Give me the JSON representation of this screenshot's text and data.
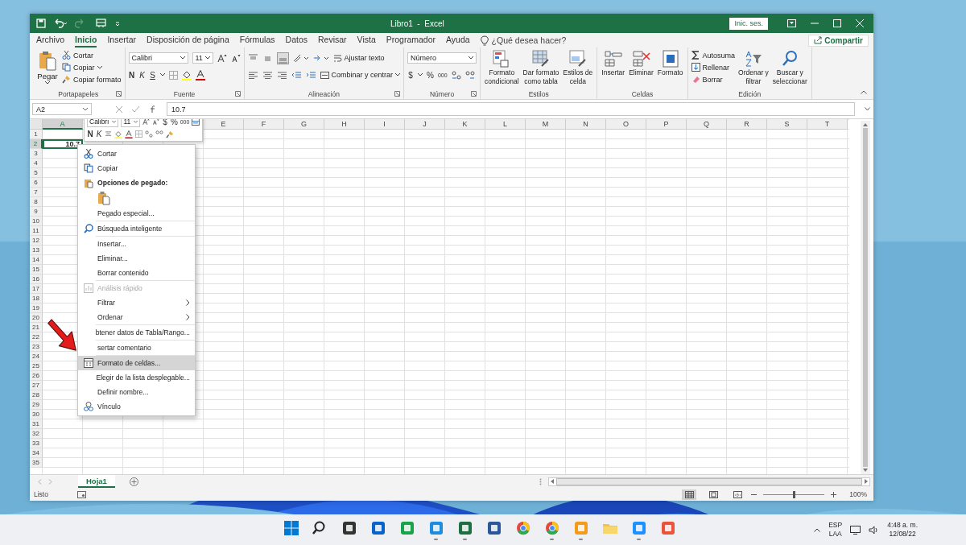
{
  "window": {
    "title": "Libro1  -  Excel",
    "signin": "Inic. ses."
  },
  "menu_tabs": [
    {
      "label": "Archivo",
      "selected": false
    },
    {
      "label": "Inicio",
      "selected": true
    },
    {
      "label": "Insertar",
      "selected": false
    },
    {
      "label": "Disposición de página",
      "selected": false
    },
    {
      "label": "Fórmulas",
      "selected": false
    },
    {
      "label": "Datos",
      "selected": false
    },
    {
      "label": "Revisar",
      "selected": false
    },
    {
      "label": "Vista",
      "selected": false
    },
    {
      "label": "Programador",
      "selected": false
    },
    {
      "label": "Ayuda",
      "selected": false
    }
  ],
  "tell_me": {
    "placeholder": "¿Qué desea hacer?"
  },
  "share": "Compartir",
  "ribbon": {
    "clipboard": {
      "label": "Portapapeles",
      "paste": "Pegar",
      "cut": "Cortar",
      "copy": "Copiar",
      "format_painter": "Copiar formato"
    },
    "font": {
      "label": "Fuente",
      "family": "Calibri",
      "size": "11",
      "bold": "N",
      "italic": "K",
      "underline": "S"
    },
    "alignment": {
      "label": "Alineación",
      "wrap": "Ajustar texto",
      "merge": "Combinar y centrar"
    },
    "number": {
      "label": "Número",
      "format": "Número",
      "currency": "$",
      "percent": "%",
      "thousands": "000"
    },
    "styles": {
      "label": "Estilos",
      "items": [
        {
          "lines": [
            "Formato",
            "condicional"
          ]
        },
        {
          "lines": [
            "Dar formato",
            "como tabla"
          ]
        },
        {
          "lines": [
            "Estilos de",
            "celda"
          ]
        }
      ]
    },
    "cells": {
      "label": "Celdas",
      "items": [
        {
          "lines": [
            "Insertar"
          ]
        },
        {
          "lines": [
            "Eliminar"
          ]
        },
        {
          "lines": [
            "Formato"
          ]
        }
      ]
    },
    "editing": {
      "label": "Edición",
      "autosum": "Autosuma",
      "fill": "Rellenar",
      "clear": "Borrar",
      "sort": {
        "lines": [
          "Ordenar y",
          "filtrar"
        ]
      },
      "find": {
        "lines": [
          "Buscar y",
          "seleccionar"
        ]
      }
    }
  },
  "formula_bar": {
    "name_box": "A2",
    "value": "10.7"
  },
  "mini_toolbar": {
    "font": "Calibri",
    "size": "11",
    "currency": "$",
    "percent": "%",
    "thousands": "000",
    "bold": "N",
    "italic": "K"
  },
  "columns": [
    {
      "label": "A",
      "selected": true
    },
    {
      "label": "E",
      "selected": false
    },
    {
      "label": "F",
      "selected": false
    },
    {
      "label": "G",
      "selected": false
    },
    {
      "label": "H",
      "selected": false
    },
    {
      "label": "I",
      "selected": false
    },
    {
      "label": "J",
      "selected": false
    },
    {
      "label": "K",
      "selected": false
    },
    {
      "label": "L",
      "selected": false
    },
    {
      "label": "M",
      "selected": false
    },
    {
      "label": "N",
      "selected": false
    },
    {
      "label": "O",
      "selected": false
    },
    {
      "label": "P",
      "selected": false
    },
    {
      "label": "Q",
      "selected": false
    },
    {
      "label": "R",
      "selected": false
    },
    {
      "label": "S",
      "selected": false
    },
    {
      "label": "T",
      "selected": false
    }
  ],
  "rows": [
    {
      "label": "1",
      "selected": false
    },
    {
      "label": "2",
      "selected": true,
      "cells": [
        "10.7"
      ]
    },
    {
      "label": "3",
      "selected": false
    },
    {
      "label": "4",
      "selected": false
    },
    {
      "label": "5",
      "selected": false
    },
    {
      "label": "6",
      "selected": false
    },
    {
      "label": "7",
      "selected": false
    },
    {
      "label": "8",
      "selected": false
    },
    {
      "label": "9",
      "selected": false
    },
    {
      "label": "10",
      "selected": false
    },
    {
      "label": "11",
      "selected": false
    },
    {
      "label": "12",
      "selected": false
    },
    {
      "label": "13",
      "selected": false
    },
    {
      "label": "14",
      "selected": false
    },
    {
      "label": "15",
      "selected": false
    },
    {
      "label": "16",
      "selected": false
    },
    {
      "label": "17",
      "selected": false
    },
    {
      "label": "18",
      "selected": false
    },
    {
      "label": "19",
      "selected": false
    },
    {
      "label": "20",
      "selected": false
    },
    {
      "label": "21",
      "selected": false
    },
    {
      "label": "22",
      "selected": false
    },
    {
      "label": "23",
      "selected": false
    },
    {
      "label": "24",
      "selected": false
    },
    {
      "label": "25",
      "selected": false
    },
    {
      "label": "26",
      "selected": false
    },
    {
      "label": "27",
      "selected": false
    },
    {
      "label": "28",
      "selected": false
    },
    {
      "label": "29",
      "selected": false
    },
    {
      "label": "30",
      "selected": false
    },
    {
      "label": "31",
      "selected": false
    },
    {
      "label": "32",
      "selected": false
    },
    {
      "label": "33",
      "selected": false
    },
    {
      "label": "34",
      "selected": false
    },
    {
      "label": "35",
      "selected": false
    }
  ],
  "context_menu": {
    "items": [
      {
        "kind": "item",
        "label": "Cortar",
        "selected": false,
        "disabled": false,
        "has_submenu": false
      },
      {
        "kind": "item",
        "label": "Copiar",
        "selected": false,
        "disabled": false,
        "has_submenu": false
      },
      {
        "kind": "header",
        "label": "Opciones de pegado:"
      },
      {
        "kind": "paste_options"
      },
      {
        "kind": "item",
        "label": "Pegado especial...",
        "selected": false,
        "disabled": false,
        "has_submenu": false
      },
      {
        "kind": "separator"
      },
      {
        "kind": "item",
        "label": "Búsqueda inteligente",
        "selected": false,
        "disabled": false,
        "has_submenu": false
      },
      {
        "kind": "separator"
      },
      {
        "kind": "item",
        "label": "Insertar...",
        "selected": false,
        "disabled": false,
        "has_submenu": false
      },
      {
        "kind": "item",
        "label": "Eliminar...",
        "selected": false,
        "disabled": false,
        "has_submenu": false
      },
      {
        "kind": "item",
        "label": "Borrar contenido",
        "selected": false,
        "disabled": false,
        "has_submenu": false
      },
      {
        "kind": "separator"
      },
      {
        "kind": "item",
        "label": "Análisis rápido",
        "selected": false,
        "disabled": true,
        "has_submenu": false
      },
      {
        "kind": "item",
        "label": "Filtrar",
        "selected": false,
        "disabled": false,
        "has_submenu": true
      },
      {
        "kind": "item",
        "label": "Ordenar",
        "selected": false,
        "disabled": false,
        "has_submenu": true
      },
      {
        "kind": "separator"
      },
      {
        "kind": "item",
        "label": "btener datos de Tabla/Rango...",
        "selected": false,
        "disabled": false,
        "has_submenu": false
      },
      {
        "kind": "separator"
      },
      {
        "kind": "item",
        "label": "sertar comentario",
        "selected": false,
        "disabled": false,
        "has_submenu": false
      },
      {
        "kind": "separator"
      },
      {
        "kind": "item",
        "label": "Formato de celdas...",
        "selected": true,
        "disabled": false,
        "has_submenu": false
      },
      {
        "kind": "item",
        "label": "Elegir de la lista desplegable...",
        "selected": false,
        "disabled": false,
        "has_submenu": false
      },
      {
        "kind": "item",
        "label": "Definir nombre...",
        "selected": false,
        "disabled": false,
        "has_submenu": false
      },
      {
        "kind": "item",
        "label": "Vínculo",
        "selected": false,
        "disabled": false,
        "has_submenu": false
      }
    ]
  },
  "sheet_tabs": [
    {
      "label": "Hoja1",
      "selected": true
    }
  ],
  "status_bar": {
    "status": "Listo",
    "views": [
      {
        "selected": true
      },
      {
        "selected": false
      },
      {
        "selected": false
      }
    ],
    "zoom": {
      "level": 0.5
    },
    "zoom_text": "100%"
  },
  "taskbar": {
    "apps": [
      {
        "running": false
      },
      {
        "running": false
      },
      {
        "running": false
      },
      {
        "running": false
      },
      {
        "running": false
      },
      {
        "running": true
      },
      {
        "running": true
      },
      {
        "running": false
      },
      {
        "running": false
      },
      {
        "running": true
      },
      {
        "running": true
      },
      {
        "running": false
      },
      {
        "running": true
      },
      {
        "running": false
      }
    ],
    "language": "ESP",
    "layout": "LAA",
    "time": "4:48 a. m.",
    "date": "12/08/22"
  }
}
